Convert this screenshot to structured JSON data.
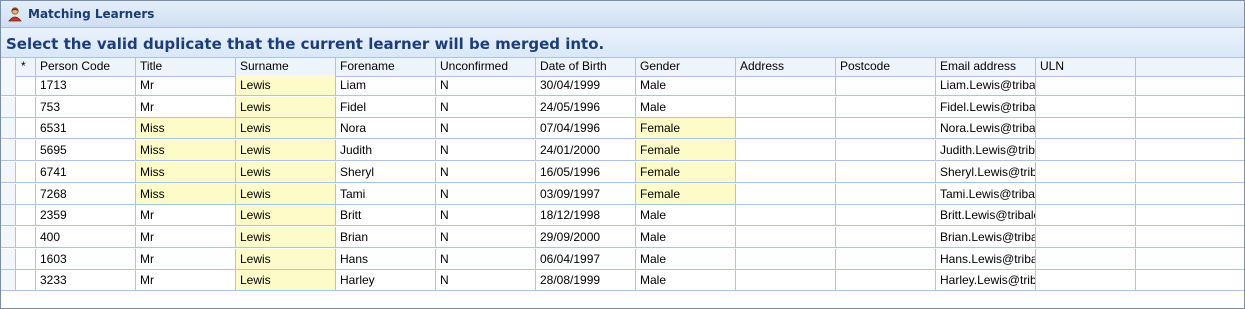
{
  "window": {
    "title": "Matching Learners"
  },
  "instruction": "Select the valid duplicate that the current learner will be merged into.",
  "columns": [
    "*",
    "Person Code",
    "Title",
    "Surname",
    "Forename",
    "Unconfirmed",
    "Date of Birth",
    "Gender",
    "Address",
    "Postcode",
    "Email address",
    "ULN"
  ],
  "rows": [
    {
      "code": "1713",
      "title": "Mr",
      "surname": "Lewis",
      "forename": "Liam",
      "unconfirmed": "N",
      "dob": "30/04/1999",
      "gender": "Male",
      "address": "",
      "postcode": "",
      "email": "Liam.Lewis@tribal",
      "uln": ""
    },
    {
      "code": "753",
      "title": "Mr",
      "surname": "Lewis",
      "forename": "Fidel",
      "unconfirmed": "N",
      "dob": "24/05/1996",
      "gender": "Male",
      "address": "",
      "postcode": "",
      "email": "Fidel.Lewis@tribal",
      "uln": ""
    },
    {
      "code": "6531",
      "title": "Miss",
      "surname": "Lewis",
      "forename": "Nora",
      "unconfirmed": "N",
      "dob": "07/04/1996",
      "gender": "Female",
      "address": "",
      "postcode": "",
      "email": "Nora.Lewis@tribal",
      "uln": ""
    },
    {
      "code": "5695",
      "title": "Miss",
      "surname": "Lewis",
      "forename": "Judith",
      "unconfirmed": "N",
      "dob": "24/01/2000",
      "gender": "Female",
      "address": "",
      "postcode": "",
      "email": "Judith.Lewis@triba",
      "uln": ""
    },
    {
      "code": "6741",
      "title": "Miss",
      "surname": "Lewis",
      "forename": "Sheryl",
      "unconfirmed": "N",
      "dob": "16/05/1996",
      "gender": "Female",
      "address": "",
      "postcode": "",
      "email": "Sheryl.Lewis@triba",
      "uln": ""
    },
    {
      "code": "7268",
      "title": "Miss",
      "surname": "Lewis",
      "forename": "Tami",
      "unconfirmed": "N",
      "dob": "03/09/1997",
      "gender": "Female",
      "address": "",
      "postcode": "",
      "email": "Tami.Lewis@tribal",
      "uln": ""
    },
    {
      "code": "2359",
      "title": "Mr",
      "surname": "Lewis",
      "forename": "Britt",
      "unconfirmed": "N",
      "dob": "18/12/1998",
      "gender": "Male",
      "address": "",
      "postcode": "",
      "email": "Britt.Lewis@tribalc",
      "uln": ""
    },
    {
      "code": "400",
      "title": "Mr",
      "surname": "Lewis",
      "forename": "Brian",
      "unconfirmed": "N",
      "dob": "29/09/2000",
      "gender": "Male",
      "address": "",
      "postcode": "",
      "email": "Brian.Lewis@tribal",
      "uln": ""
    },
    {
      "code": "1603",
      "title": "Mr",
      "surname": "Lewis",
      "forename": "Hans",
      "unconfirmed": "N",
      "dob": "06/04/1997",
      "gender": "Male",
      "address": "",
      "postcode": "",
      "email": "Hans.Lewis@tribal",
      "uln": ""
    },
    {
      "code": "3233",
      "title": "Mr",
      "surname": "Lewis",
      "forename": "Harley",
      "unconfirmed": "N",
      "dob": "28/08/1999",
      "gender": "Male",
      "address": "",
      "postcode": "",
      "email": "Harley.Lewis@triba",
      "uln": ""
    }
  ],
  "colors": {
    "highlight": "#fdfbc8",
    "grid_line": "#a9c4e6",
    "title_text": "#1d3d7a"
  },
  "icons": {
    "window_icon": "learner-icon"
  }
}
